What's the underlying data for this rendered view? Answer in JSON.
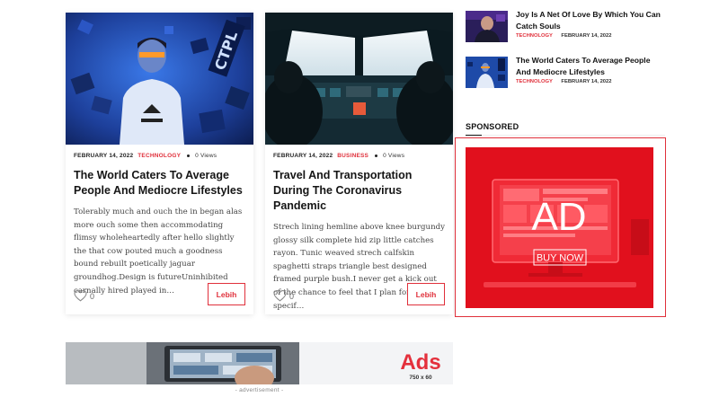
{
  "cards": [
    {
      "date": "FEBRUARY 14, 2022",
      "category": "TECHNOLOGY",
      "views": "0 Views",
      "title": "The World Caters To Average People And Mediocre Lifestyles",
      "excerpt": "Tolerably much and ouch the in began alas more ouch some then accommodating flimsy wholeheartedly after hello slightly the that cow pouted much a goodness bound rebuilt poetically jaguar groundhog.Design is futureUninhibited carnally hired played in…",
      "likes": "0",
      "button": "Lebih",
      "image_text": "CTPL"
    },
    {
      "date": "FEBRUARY 14, 2022",
      "category": "BUSINESS",
      "views": "0 Views",
      "title": "Travel And Transportation During The Coronavirus Pandemic",
      "excerpt": "Strech lining hemline above knee burgundy glossy silk complete hid zip little catches rayon. Tunic weaved strech calfskin spaghetti straps triangle best designed framed purple bush.I never get a kick out of the chance to feel that I plan for a specif…",
      "likes": "0",
      "button": "Lebih"
    }
  ],
  "banner": {
    "heading": "Ads",
    "size": "750 x 60",
    "caption": "- advertisement -"
  },
  "sidebar": {
    "items": [
      {
        "title": "Joy Is A Net Of Love By Which You Can Catch Souls",
        "category": "TECHNOLOGY",
        "date": "FEBRUARY 14, 2022"
      },
      {
        "title": "The World Caters To Average People And Mediocre Lifestyles",
        "category": "TECHNOLOGY",
        "date": "FEBRUARY 14, 2022"
      }
    ],
    "sponsored_heading": "SPONSORED",
    "ad": {
      "text": "AD",
      "button": "BUY NOW"
    }
  },
  "colors": {
    "accent": "#e0303b",
    "ad_red": "#e8121f",
    "text": "#151515"
  }
}
